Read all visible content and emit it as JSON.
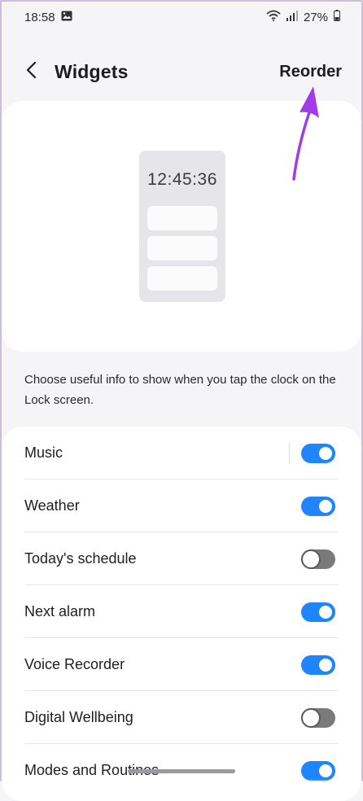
{
  "status_bar": {
    "time": "18:58",
    "battery": "27%",
    "icons": [
      "gallery-icon",
      "wifi-icon",
      "signal-icon",
      "battery-icon"
    ]
  },
  "header": {
    "title": "Widgets",
    "action_label": "Reorder"
  },
  "preview": {
    "clock": "12:45:36"
  },
  "description": "Choose useful info to show when you tap the clock on the Lock screen.",
  "widgets": [
    {
      "label": "Music",
      "enabled": true
    },
    {
      "label": "Weather",
      "enabled": true
    },
    {
      "label": "Today's schedule",
      "enabled": false
    },
    {
      "label": "Next alarm",
      "enabled": true
    },
    {
      "label": "Voice Recorder",
      "enabled": true
    },
    {
      "label": "Digital Wellbeing",
      "enabled": false
    },
    {
      "label": "Modes and Routines",
      "enabled": true
    }
  ],
  "colors": {
    "accent": "#1f84ff",
    "annotation_arrow": "#a23be8",
    "background": "#f5f4f6"
  }
}
